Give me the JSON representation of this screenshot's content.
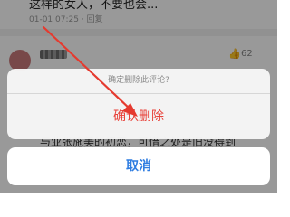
{
  "feed": {
    "top_comment_text": "这样的女人，不要也会...",
    "top_comment_date": "01-01 07:25",
    "top_comment_sep": "·",
    "top_comment_reply": "回复",
    "like_icon": "thumbs-up-icon",
    "like_count": "62",
    "bottom_comment_text": "与业张施美的初恋，可惜之处是旧没得到"
  },
  "action_sheet": {
    "title": "确定删除此评论?",
    "confirm_label": "确认删除",
    "cancel_label": "取消"
  },
  "colors": {
    "confirm": "#e8423a",
    "cancel": "#2f7de1",
    "annotation_arrow": "#e53a2f"
  }
}
